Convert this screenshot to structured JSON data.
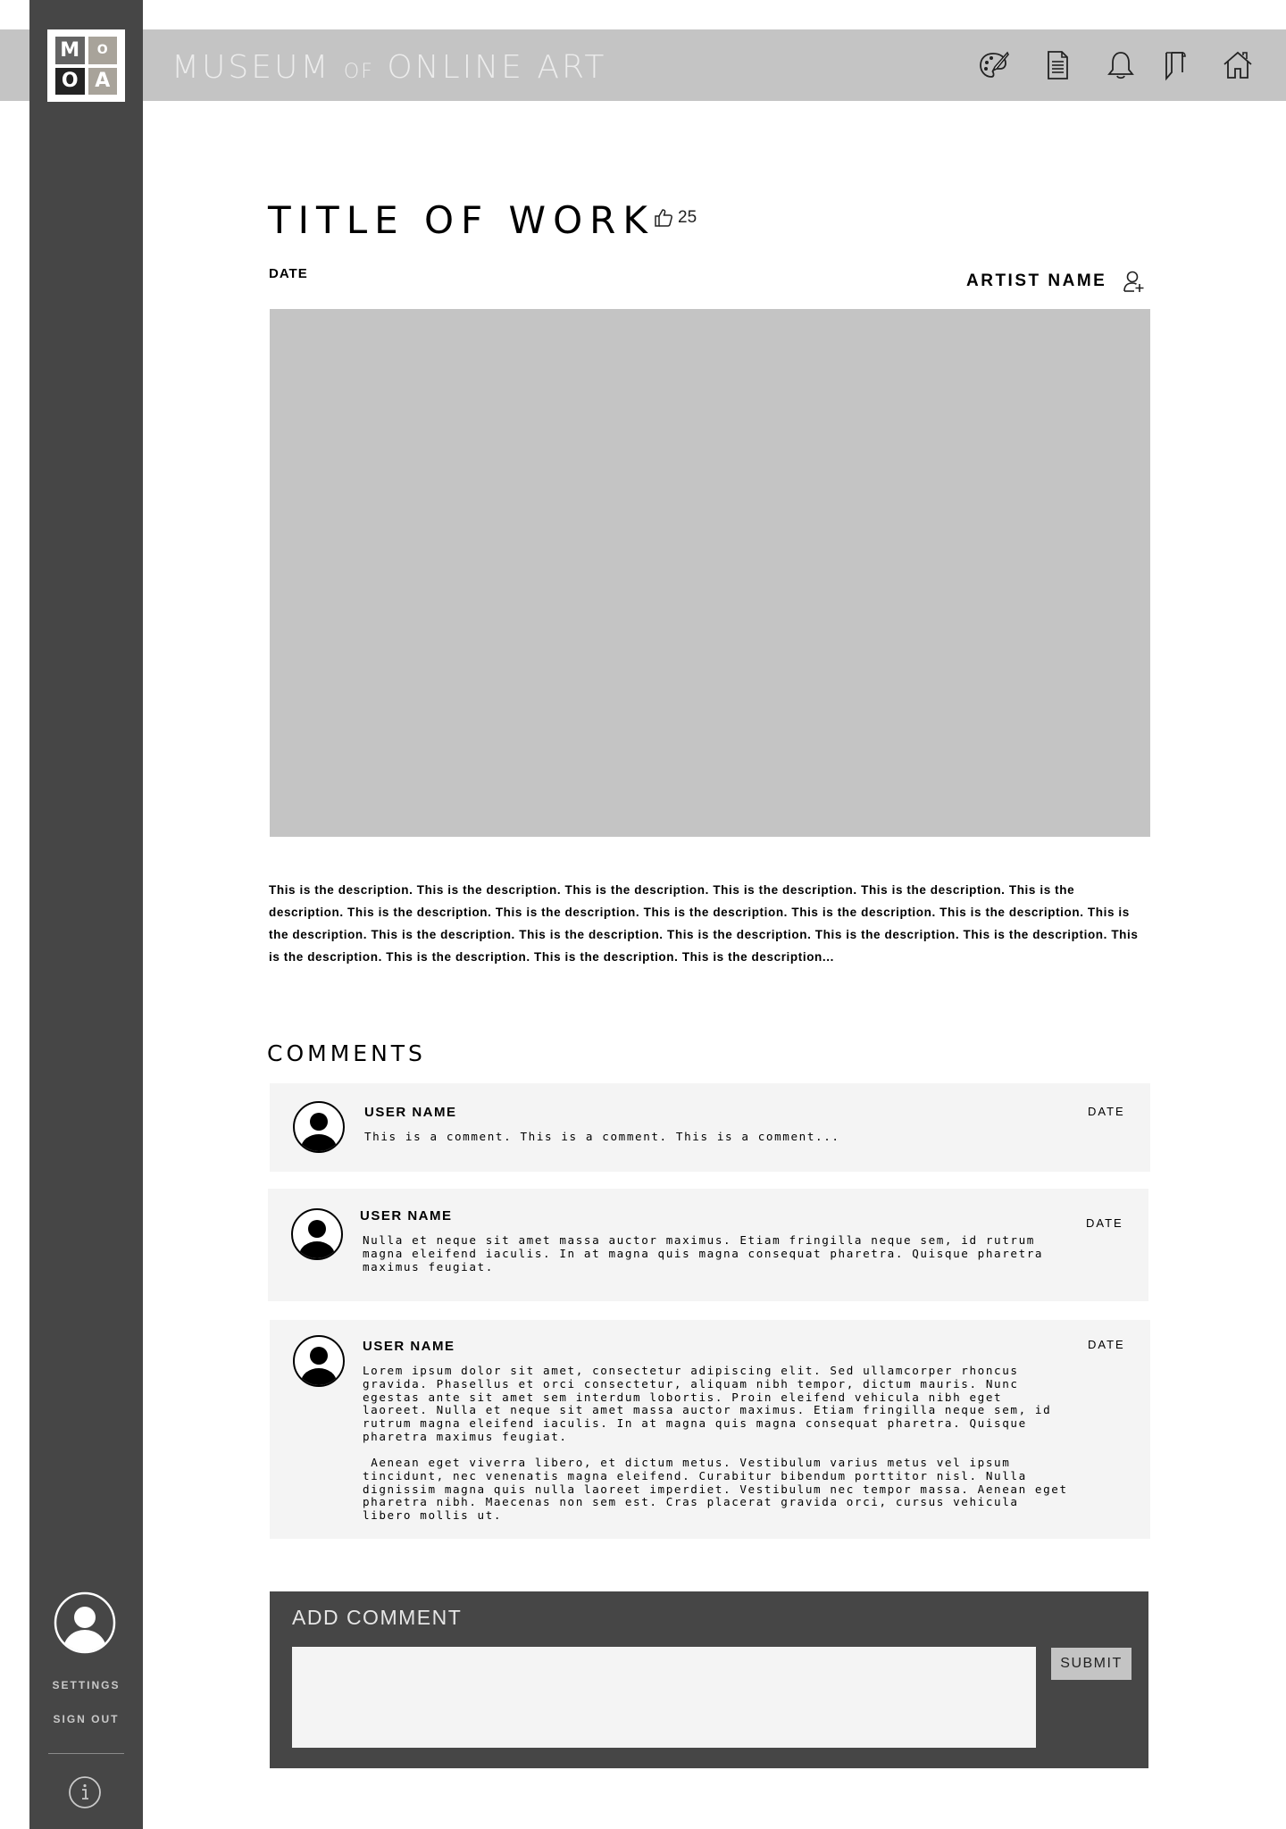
{
  "brand": {
    "logo_letters": [
      "M",
      "O",
      "O",
      "A"
    ],
    "name_part1": "MUSEUM",
    "name_of": "OF",
    "name_part2": "ONLINE ART"
  },
  "header_icons": [
    "palette-icon",
    "document-icon",
    "bell-icon",
    "bookmark-icon",
    "home-icon"
  ],
  "work": {
    "title": "TITLE OF WORK",
    "likes": "25",
    "date": "DATE",
    "artist_name": "ARTIST NAME",
    "description": "This is the description. This is the description. This is the description. This is the description. This is the description. This is the description. This is the description. This is the description. This is the description. This is the description. This is the description. This is the description. This is the description. This is the description. This is the description. This is the description. This is the description. This is the description. This is the description. This is the description. This is the description..."
  },
  "comments": {
    "heading": "COMMENTS",
    "items": [
      {
        "user": "USER NAME",
        "date": "DATE",
        "text": "This is a comment. This is a comment. This is a comment..."
      },
      {
        "user": "USER NAME",
        "date": "DATE",
        "text": "Nulla et neque sit amet massa auctor maximus. Etiam fringilla neque sem, id rutrum magna eleifend iaculis. In at magna quis magna consequat pharetra. Quisque pharetra maximus feugiat."
      },
      {
        "user": "USER NAME",
        "date": "DATE",
        "text": "Lorem ipsum dolor sit amet, consectetur adipiscing elit. Sed ullamcorper rhoncus gravida. Phasellus et orci consectetur, aliquam nibh tempor, dictum mauris. Nunc egestas ante sit amet sem interdum lobortis. Proin eleifend vehicula nibh eget laoreet. Nulla et neque sit amet massa auctor maximus. Etiam fringilla neque sem, id rutrum magna eleifend iaculis. In at magna quis magna consequat pharetra. Quisque pharetra maximus feugiat.",
        "text2": " Aenean eget viverra libero, et dictum metus. Vestibulum varius metus vel ipsum tincidunt, nec venenatis magna eleifend. Curabitur bibendum porttitor nisl. Nulla dignissim magna quis nulla laoreet imperdiet. Vestibulum nec tempor massa. Aenean eget pharetra nibh. Maecenas non sem est. Cras placerat gravida orci, cursus vehicula libero mollis ut."
      }
    ]
  },
  "add_comment": {
    "title": "ADD COMMENT",
    "input_value": "",
    "submit_label": "SUBMIT"
  },
  "sidebar": {
    "settings": "SETTINGS",
    "sign_out": "SIGN OUT"
  },
  "colors": {
    "sidebar": "#464646",
    "header": "#c4c4c4",
    "comment_bg": "#f4f4f4"
  }
}
